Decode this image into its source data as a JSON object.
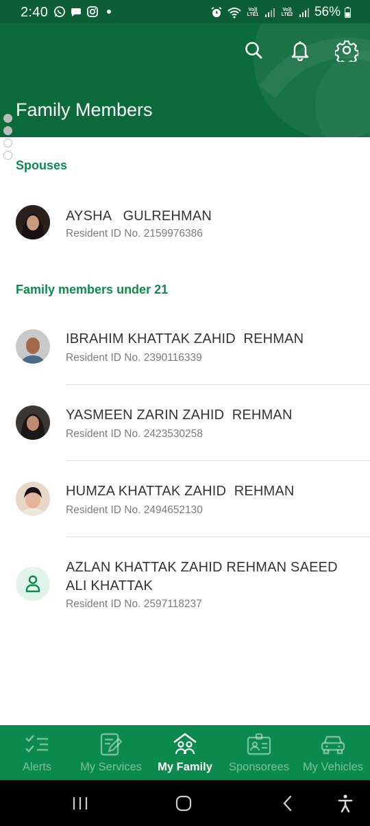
{
  "status_bar": {
    "time": "2:40",
    "net1": "Vo)) LTE1",
    "net2": "Vo)) LTE2",
    "battery": "56%"
  },
  "header": {
    "title": "Family Members",
    "search_icon": "search-icon",
    "bell_icon": "bell-icon",
    "settings_icon": "gear-icon",
    "color": "#0b6b3a"
  },
  "sections": {
    "spouses_title": "Spouses",
    "children_title": "Family members under 21"
  },
  "spouses": [
    {
      "name": "AYSHA   GULREHMAN",
      "id_label": "Resident ID No. 2159976386"
    }
  ],
  "children": [
    {
      "name": "IBRAHIM KHATTAK ZAHID  REHMAN",
      "id_label": "Resident ID No. 2390116339"
    },
    {
      "name": "YASMEEN ZARIN ZAHID  REHMAN",
      "id_label": "Resident ID No. 2423530258"
    },
    {
      "name": "HUMZA KHATTAK ZAHID  REHMAN",
      "id_label": "Resident ID No. 2494652130"
    },
    {
      "name": "AZLAN KHATTAK ZAHID REHMAN SAEED\nALI KHATTAK",
      "id_label": "Resident ID No. 2597118237"
    }
  ],
  "bottom_nav": {
    "items": [
      {
        "label": "Alerts",
        "icon": "checklist-icon",
        "active": false
      },
      {
        "label": "My Services",
        "icon": "edit-document-icon",
        "active": false
      },
      {
        "label": "My Family",
        "icon": "family-home-icon",
        "active": true
      },
      {
        "label": "Sponsorees",
        "icon": "id-card-icon",
        "active": false
      },
      {
        "label": "My Vehicles",
        "icon": "car-icon",
        "active": false
      }
    ],
    "color": "#0b8a4e"
  }
}
